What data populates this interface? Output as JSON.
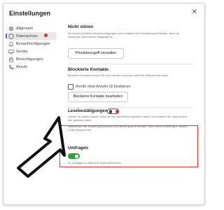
{
  "window": {
    "title": "Einstellungen",
    "close_glyph": "✕"
  },
  "sidebar": {
    "items": [
      {
        "label": "Allgemein",
        "icon": "gear-icon"
      },
      {
        "label": "Datenschutz",
        "icon": "shield-icon",
        "active": true
      },
      {
        "label": "Benachrichtigungen",
        "icon": "bell-icon"
      },
      {
        "label": "Geräte",
        "icon": "device-icon"
      },
      {
        "label": "Berechtigungen",
        "icon": "lock-icon"
      },
      {
        "label": "Anrufe",
        "icon": "phone-icon"
      }
    ]
  },
  "sections": {
    "nicht_stoeren": {
      "title": "Nicht stören",
      "desc": "Sie können weiterhin Benachrichtigungen von Kontakten mit Prioritätszugriff erhalten, wenn Ihr Status auf „Nicht stören“ festgelegt ist.",
      "button": "Prioritätszugriff verwalten"
    },
    "blockierte_kontakte": {
      "title": "Blockierte Kontakte",
      "desc": "Blockierte Kontakte können Sie nicht anrufen und auch nicht Ihre Anwesenheit sehen.",
      "checkbox_label": "Anrufe ohne Anrufer-ID blockieren",
      "button": "Blockierte Kontakte bearbeiten"
    },
    "lesebestaetigungen": {
      "title": "Lesebestätigungen",
      "toggle_on": false,
      "desc1": "Lassen Sie andere wissen, dass Sie ihre Nachrichten gesehen haben, und erfahren Sie, dass andere Ihre gesehen haben.",
      "desc2": "Mitteilenden hat, müssen geschlossen und wieder geöffnet werden, damit diese Einstellung in diesem Chats wirksam wird."
    },
    "umfragen": {
      "title": "Umfragen",
      "toggle_on": true,
      "desc": "An Umfragen zu Microsoft Teams teilnehmen"
    }
  },
  "colors": {
    "accent": "#5b5fc7",
    "highlight": "#d93a3a",
    "toggle_on": "#2e9e3e",
    "badge": "#d13438"
  }
}
